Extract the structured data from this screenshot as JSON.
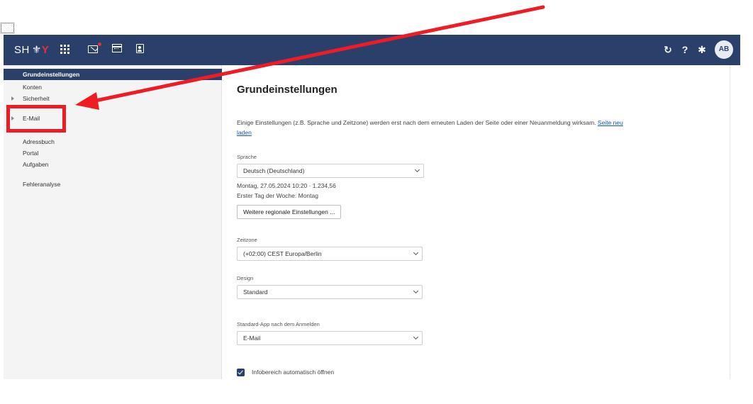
{
  "topbar": {
    "brand_text": "SH",
    "logo_glyph": "⚜",
    "icons": [
      "apps-grid-icon",
      "mail-icon",
      "calendar-icon",
      "address-book-icon"
    ],
    "right_icons": [
      "refresh-icon",
      "help-icon",
      "gear-icon"
    ],
    "refresh_glyph": "↻",
    "help_glyph": "?",
    "gear_glyph": "✱",
    "avatar_initials": "AB",
    "colors": {
      "bar": "#2b3f6b",
      "accent": "#e2323a"
    }
  },
  "sidebar": {
    "items": [
      {
        "label": "Grundeinstellungen",
        "active": true
      },
      {
        "label": "Konten"
      },
      {
        "label": "Sicherheit",
        "expandable": true
      },
      {
        "label": "E-Mail",
        "expandable": true
      },
      {
        "label": "Adressbuch"
      },
      {
        "label": "Portal"
      },
      {
        "label": "Aufgaben"
      },
      {
        "label": "Fehleranalyse"
      }
    ]
  },
  "main": {
    "title": "Grundeinstellungen",
    "note_text": "Einige Einstellungen (z.B. Sprache und Zeitzone) werden erst nach dem erneuten Laden der Seite oder einer Neuanmeldung wirksam.",
    "reload_link": "Seite neu laden",
    "language": {
      "label": "Sprache",
      "value": "Deutsch (Deutschland)",
      "preview_line": "Montag, 27.05.2024 10:20 · 1.234,56",
      "first_day_line": "Erster Tag der Woche: Montag",
      "more_button": "Weitere regionale Einstellungen ..."
    },
    "timezone": {
      "label": "Zeitzone",
      "value": "(+02:00) CEST Europa/Berlin"
    },
    "design": {
      "label": "Design",
      "value": "Standard"
    },
    "default_app": {
      "label": "Standard-App nach dem Anmelden",
      "value": "E-Mail"
    },
    "infobox": {
      "label": "Infobereich automatisch öffnen",
      "checked": true
    }
  },
  "annotation": {
    "color": "#ee1c24"
  }
}
